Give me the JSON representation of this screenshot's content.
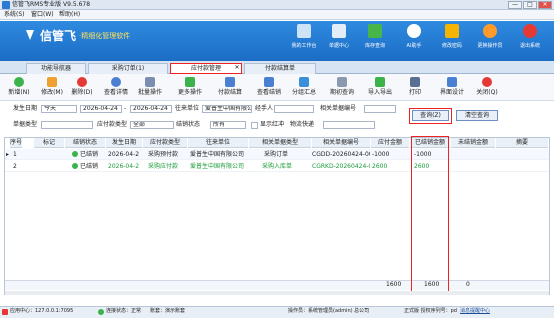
{
  "window": {
    "title": "信管飞RMS专业版 V9.5.678",
    "min": "—",
    "max": "□",
    "close": "✕"
  },
  "menu": [
    "系统(S)",
    "窗口(W)",
    "帮助(H)"
  ],
  "header": {
    "brand": "信管飞",
    "slogan": "·精细化管理软件",
    "buttons": [
      {
        "label": "我的工作台",
        "color": "#cfe3f7"
      },
      {
        "label": "单据中心",
        "color": "#e3edf8"
      },
      {
        "label": "库存查询",
        "color": "#47b548"
      },
      {
        "label": "AI助手",
        "color": "#ffffff"
      },
      {
        "label": "修改密码",
        "color": "#f4b400"
      },
      {
        "label": "更换操作员",
        "color": "#ff9a2b"
      },
      {
        "label": "退出系统",
        "color": "#e53935"
      }
    ]
  },
  "tabs": [
    {
      "label": "功能导航器"
    },
    {
      "label": "采购订单(1)"
    },
    {
      "label": "应付款管理"
    },
    {
      "label": "付款结算单"
    }
  ],
  "tab_close": "✕",
  "toolbar": [
    {
      "label": "新增(N)",
      "color": "#3bb34a"
    },
    {
      "label": "修改(M)",
      "color": "#f0a030"
    },
    {
      "label": "删除(D)",
      "color": "#e53935"
    },
    {
      "label": "查看详情",
      "color": "#4a7fd1"
    },
    {
      "label": "批量操作",
      "color": "#7a8fb0"
    },
    {
      "label": "更多操作",
      "color": "#3bb34a"
    },
    {
      "label": "付款结算",
      "color": "#4a7fd1"
    },
    {
      "label": "查看结销",
      "color": "#4a7fd1"
    },
    {
      "label": "分组汇总",
      "color": "#3a8fd6"
    },
    {
      "label": "期初查询",
      "color": "#8a99b0"
    },
    {
      "label": "导入导出",
      "color": "#3bb34a"
    },
    {
      "label": "打印",
      "color": "#5a6f92"
    },
    {
      "label": "界面设计",
      "color": "#4a7fd1"
    },
    {
      "label": "关闭(Q)",
      "color": "#e53935"
    }
  ],
  "filter": {
    "date_label": "发生日期",
    "date_range": "今天",
    "date_from": "2026-04-24",
    "date_to": "2026-04-24",
    "unit_label": "往来单位",
    "unit_value": "爱普生中国有限公司",
    "handler_label": "经手人",
    "handler_value": "",
    "related_no_label": "相关单据编号",
    "related_no_value": "",
    "doc_type_label": "单据类型",
    "doc_type_value": "",
    "pay_type_label": "应付款类型",
    "pay_type_value": "全部",
    "settle_label": "结销状态",
    "settle_value": "所有",
    "show_red_label": "显示红冲",
    "show_red_checked": false,
    "logistics_label": "物流快递",
    "logistics_value": "",
    "query_btn": "查询(Z)",
    "clear_btn": "清空查询"
  },
  "table": {
    "columns": [
      "序号",
      "标记",
      "结销状态",
      "发生日期",
      "应付款类型",
      "往来单位",
      "相关单据类型",
      "相关单据编号",
      "应付金额",
      "已结销金额",
      "未结销金额",
      "摘要"
    ],
    "rows": [
      {
        "no": "1",
        "mark": "",
        "status": "已结销",
        "date": "2026-04-2",
        "type": "采购预付款",
        "unit": "爱普生中国有限公司",
        "rel_type": "采购订单",
        "rel_no": "CGDD-20260424-000",
        "amount": "-1000",
        "settled": "-1000",
        "unsettled": "0",
        "memo": ""
      },
      {
        "no": "2",
        "mark": "",
        "status": "已结销",
        "date": "2026-04-2",
        "type": "采购应付款",
        "unit": "爱普生中国有限公司",
        "rel_type": "采购入库单",
        "rel_no": "CGRKD-20260424-000",
        "amount": "2600",
        "settled": "2600",
        "unsettled": "0",
        "memo": ""
      }
    ],
    "summary": {
      "amount": "1600",
      "settled": "1600",
      "unsettled": "0"
    }
  },
  "status": {
    "app_center": "应用中心：127.0.0.1:7095",
    "conn": "连接状态：正常",
    "account": "账套：演示账套",
    "operator": "操作员：系统管理员(admin) 总公司",
    "license": "正式版 授权序列号：pd",
    "message": "消息提醒中心"
  }
}
